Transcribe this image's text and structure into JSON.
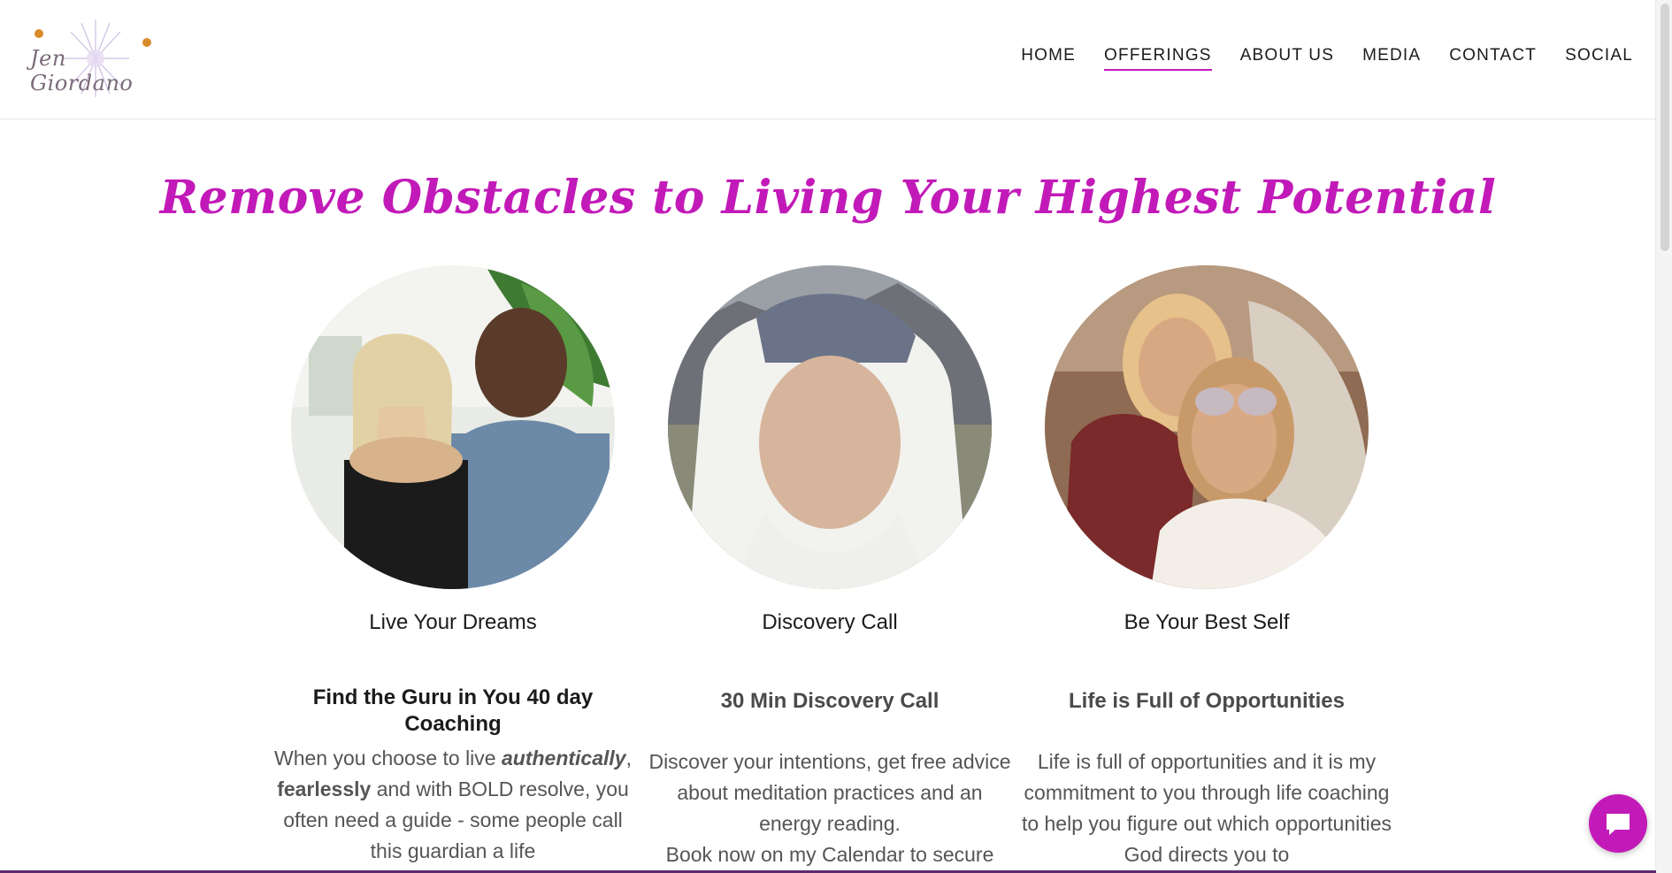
{
  "brand": {
    "logo_text": "Jen Giordano"
  },
  "nav": {
    "items": [
      {
        "label": "HOME",
        "active": false
      },
      {
        "label": "OFFERINGS",
        "active": true
      },
      {
        "label": "ABOUT US",
        "active": false
      },
      {
        "label": "MEDIA",
        "active": false
      },
      {
        "label": "CONTACT",
        "active": false
      },
      {
        "label": "SOCIAL",
        "active": false
      }
    ]
  },
  "main": {
    "headline": "Remove Obstacles to Living Your Highest Potential",
    "cards": [
      {
        "title": "Live Your Dreams",
        "subtitle": "Find the Guru in You 40 day Coaching",
        "body_prefix": "When you choose to live ",
        "body_em": "authentically",
        "body_mid": ", ",
        "body_strong": "fearlessly",
        "body_suffix": " and with BOLD resolve, you often need a guide - some people call this guardian a life"
      },
      {
        "title": "Discovery Call",
        "subtitle": "30 Min Discovery Call",
        "body": "Discover your intentions, get free advice about meditation practices and an energy reading.",
        "body_2": "Book now on my Calendar to secure"
      },
      {
        "title": "Be Your Best Self",
        "subtitle": "Life is Full of Opportunities",
        "body": "Life is full of opportunities and it is my commitment to you through life coaching to help you figure out which opportunities God directs you to"
      }
    ]
  },
  "colors": {
    "accent": "#c21ab8",
    "text": "#1b1b1b",
    "muted": "#555555"
  },
  "icons": {
    "chat": "chat-bubble-icon"
  }
}
